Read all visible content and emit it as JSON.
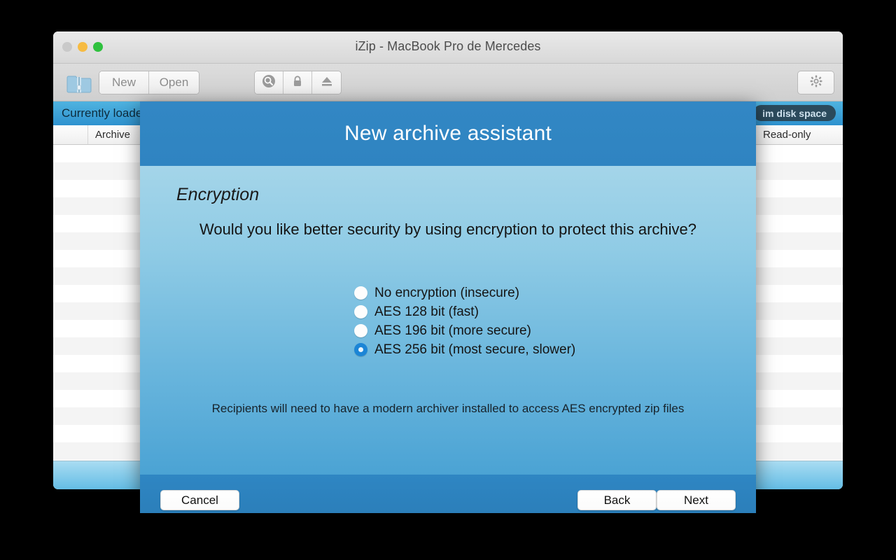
{
  "window": {
    "title": "iZip - MacBook Pro de Mercedes",
    "traffic_lights": [
      "close",
      "minimize",
      "maximize"
    ],
    "toolbar": {
      "app_icon": "zip-folder-icon",
      "new_label": "New",
      "open_label": "Open",
      "search_icon": "search-icon",
      "lock_icon": "lock-icon",
      "eject_icon": "eject-icon",
      "settings_icon": "gear-icon"
    },
    "status_bar": {
      "text": "Currently loaded",
      "reclaim_button": "im disk space"
    },
    "table": {
      "columns": [
        "",
        "Archive",
        "Read-only"
      ],
      "row_count": 19
    }
  },
  "dialog": {
    "title": "New archive assistant",
    "section": "Encryption",
    "question": "Would you like better security by using encryption to protect this archive?",
    "options": [
      {
        "label": "No encryption (insecure)",
        "selected": false
      },
      {
        "label": "AES 128 bit (fast)",
        "selected": false
      },
      {
        "label": "AES 196 bit (more secure)",
        "selected": false
      },
      {
        "label": "AES 256 bit (most secure, slower)",
        "selected": true
      }
    ],
    "footnote": "Recipients will need to have a modern archiver installed to access AES encrypted zip files",
    "buttons": {
      "cancel": "Cancel",
      "back": "Back",
      "next": "Next"
    }
  },
  "colors": {
    "header_blue": "#3287c4",
    "body_top": "#a4d5e9",
    "body_bottom": "#4ba3d4",
    "accent_radio": "#1b85d6",
    "status_bar": "#2e92cf"
  }
}
